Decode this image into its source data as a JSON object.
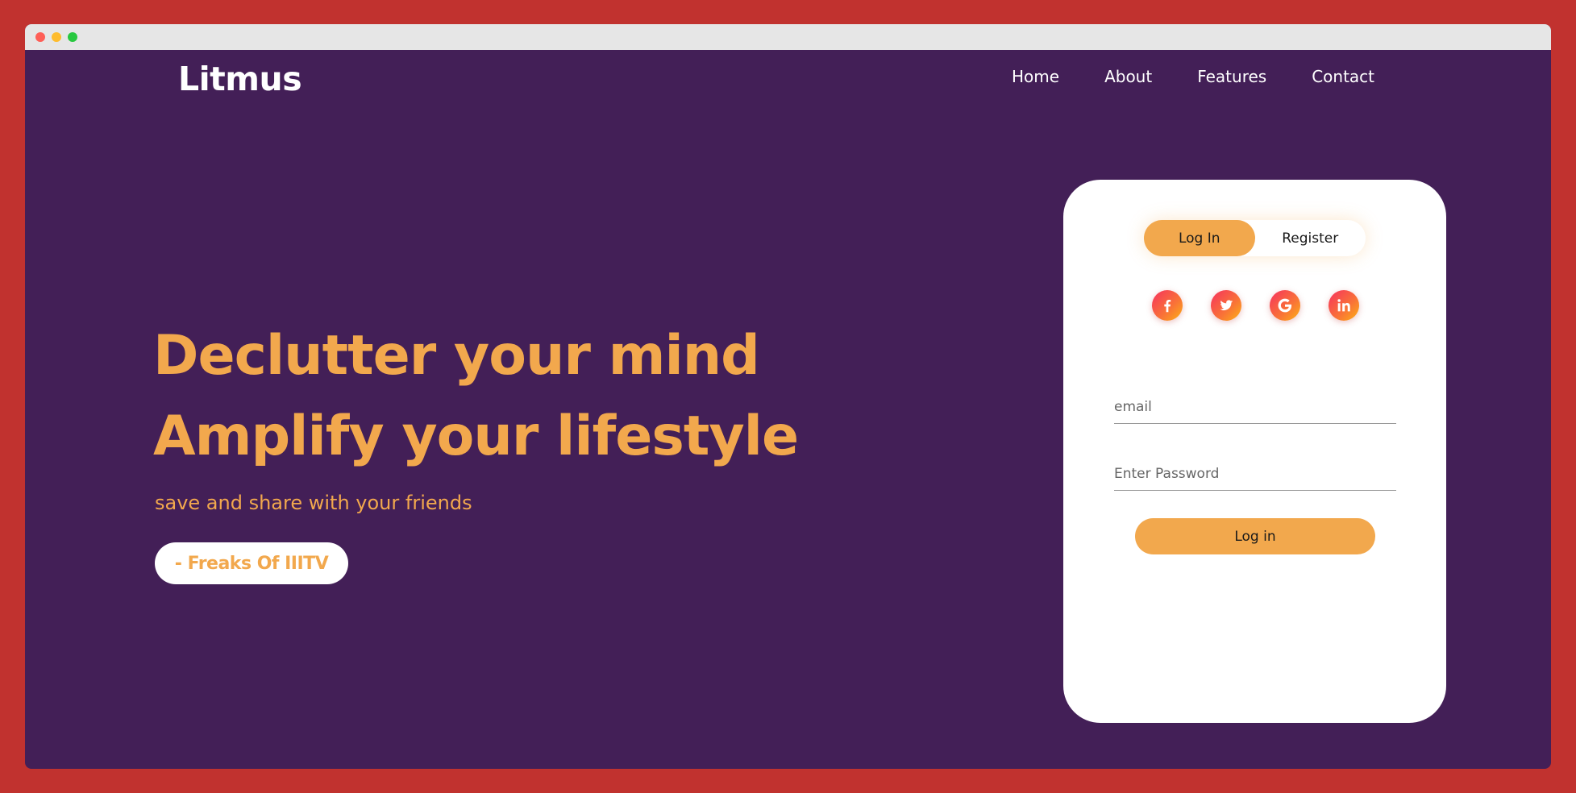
{
  "window": {
    "controls": [
      "close",
      "minimize",
      "maximize"
    ]
  },
  "header": {
    "logo": "Litmus",
    "nav": [
      "Home",
      "About",
      "Features",
      "Contact"
    ]
  },
  "hero": {
    "line1": "Declutter your mind",
    "line2": "Amplify your lifestyle",
    "subtitle": "save and share with your friends",
    "tag_button": "- Freaks Of IIITV"
  },
  "auth_card": {
    "tabs": [
      {
        "label": "Log In",
        "active": true
      },
      {
        "label": "Register",
        "active": false
      }
    ],
    "socials": [
      {
        "icon": "facebook-icon"
      },
      {
        "icon": "twitter-icon"
      },
      {
        "icon": "google-icon"
      },
      {
        "icon": "linkedin-icon"
      }
    ],
    "email_placeholder": "email",
    "password_placeholder": "Enter Password",
    "submit_label": "Log in"
  },
  "colors": {
    "background": "#431f57",
    "frame": "#c1322f",
    "accent": "#f2a84d",
    "card": "#ffffff"
  }
}
